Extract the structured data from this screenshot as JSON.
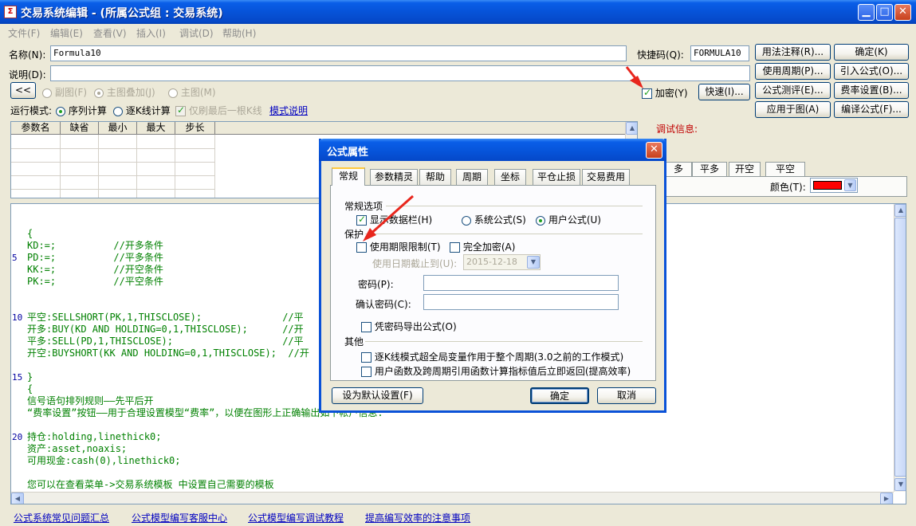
{
  "window": {
    "title": "交易系统编辑 - (所属公式组 : 交易系统)",
    "app_icon": "Σ",
    "min": "▁",
    "max": "□",
    "close": "✕"
  },
  "menu": [
    "文件(F)",
    "编辑(E)",
    "查看(V)",
    "插入(I)",
    "调试(D)",
    "帮助(H)"
  ],
  "form": {
    "name_label": "名称(N):",
    "name_value": "Formula10",
    "desc_label": "说明(D):",
    "desc_value": "",
    "shortcut_label": "快捷码(Q):",
    "shortcut_value": "FORMULA10",
    "collapse_btn": "<<",
    "radio_subchart": "副图(F)",
    "radio_overlay": "主图叠加(J)",
    "radio_main": "主图(M)",
    "encrypt_label": "加密(Y)",
    "quick_btn": "快速(I)...",
    "run_mode_label": "运行模式:",
    "mode_seq": "序列计算",
    "mode_kline": "逐K线计算",
    "mode_lastbar": "仅刷最后一根K线",
    "mode_link": "模式说明",
    "debug_label": "调试信息:"
  },
  "right_buttons": [
    [
      "用法注释(R)...",
      "确定(K)"
    ],
    [
      "使用周期(P)...",
      "引入公式(O)..."
    ],
    [
      "公式测评(E)...",
      "费率设置(B)..."
    ],
    [
      "应用于图(A)",
      "编译公式(F)..."
    ]
  ],
  "param_headers": [
    "参数名",
    "缺省",
    "最小",
    "最大",
    "步长"
  ],
  "right_tabs": [
    "多",
    "平多",
    "开空",
    "平空"
  ],
  "color_label": "颜色(T):",
  "color_value": "#ff0000",
  "code": [
    {
      "no": "",
      "text": "{"
    },
    {
      "no": "",
      "text": "KD:=;          //开多条件"
    },
    {
      "no": "5",
      "text": "PD:=;          //平多条件"
    },
    {
      "no": "",
      "text": "KK:=;          //开空条件"
    },
    {
      "no": "",
      "text": "PK:=;          //平空条件"
    },
    {
      "no": "",
      "text": ""
    },
    {
      "no": "",
      "text": ""
    },
    {
      "no": "10",
      "text": "平空:SELLSHORT(PK,1,THISCLOSE);              //平"
    },
    {
      "no": "",
      "text": "开多:BUY(KD AND HOLDING=0,1,THISCLOSE);      //开"
    },
    {
      "no": "",
      "text": "平多:SELL(PD,1,THISCLOSE);                   //平"
    },
    {
      "no": "",
      "text": "开空:BUYSHORT(KK AND HOLDING=0,1,THISCLOSE);  //开"
    },
    {
      "no": "",
      "text": ""
    },
    {
      "no": "15",
      "text": "}"
    },
    {
      "no": "",
      "text": "{"
    },
    {
      "no": "",
      "text": "信号语句排列规则——先平后开"
    },
    {
      "no": "",
      "text": "“费率设置”按钮——用于合理设置模型“费率”，以便在图形上正确输出如下帐户信息:"
    },
    {
      "no": "",
      "text": ""
    },
    {
      "no": "20",
      "text": "持仓:holding,linethick0;"
    },
    {
      "no": "",
      "text": "资产:asset,noaxis;"
    },
    {
      "no": "",
      "text": "可用现金:cash(0),linethick0;"
    },
    {
      "no": "",
      "text": ""
    },
    {
      "no": "",
      "text": "您可以在查看菜单->交易系统模板 中设置自己需要的模板"
    }
  ],
  "bottom_links": [
    "公式系统常见问题汇总",
    "公式模型编写客服中心",
    "公式模型编写调试教程",
    "提高编写效率的注意事项"
  ],
  "dialog": {
    "title": "公式属性",
    "tabs": [
      "常规",
      "参数精灵",
      "帮助",
      "周期",
      "坐标",
      "平仓止损",
      "交易费用"
    ],
    "group_general": "常规选项",
    "show_databar": "显示数据栏(H)",
    "sys_formula": "系统公式(S)",
    "user_formula": "用户公式(U)",
    "group_protect": "保护",
    "use_date_limit": "使用期限限制(T)",
    "full_encrypt": "完全加密(A)",
    "use_until_label": "使用日期截止到(U):",
    "use_until_value": "2015-12-18",
    "password_label": "密码(P):",
    "confirm_label": "确认密码(C):",
    "export_with_pwd": "凭密码导出公式(O)",
    "group_other": "其他",
    "other1": "逐K线模式超全局变量作用于整个周期(3.0之前的工作模式)",
    "other2": "用户函数及跨周期引用函数计算指标值后立即返回(提高效率)",
    "default_btn": "设为默认设置(F)",
    "ok_btn": "确定",
    "cancel_btn": "取消"
  }
}
